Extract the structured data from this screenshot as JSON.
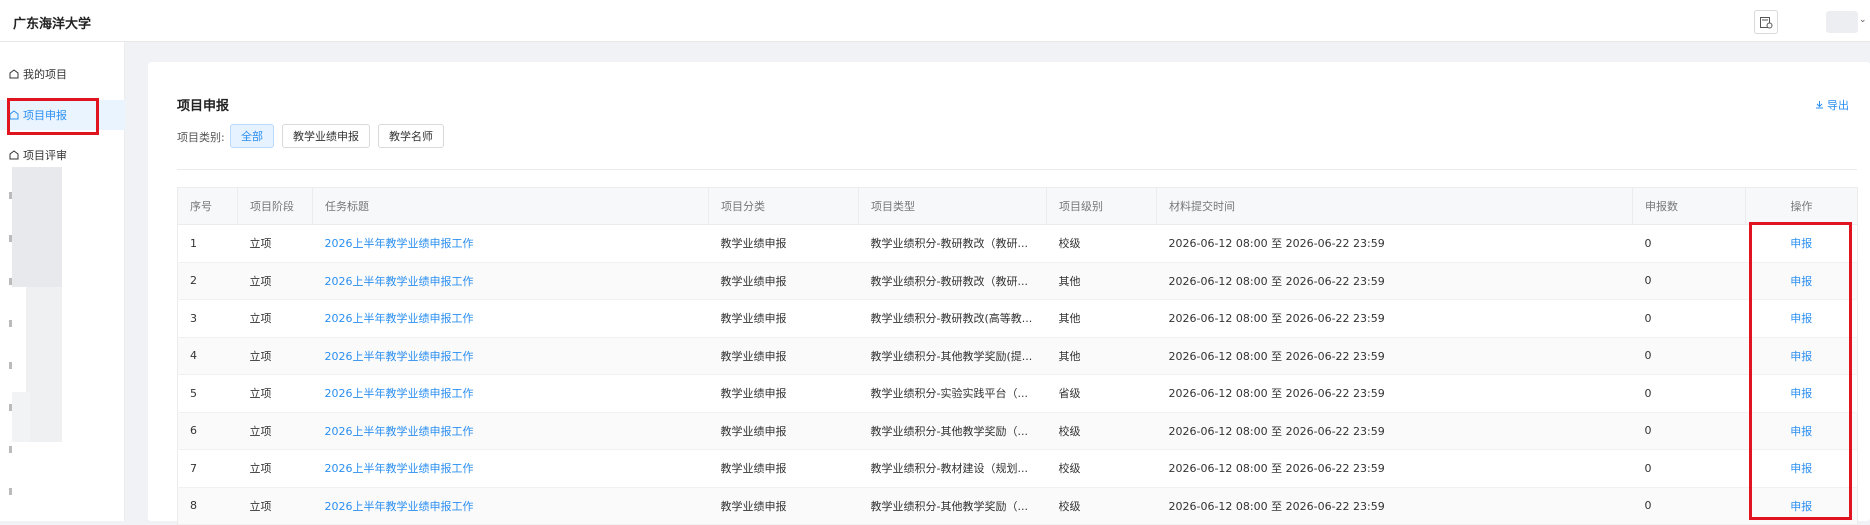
{
  "app": {
    "title": "广东海洋大学"
  },
  "sidebar": {
    "items": [
      {
        "label": "我的项目"
      },
      {
        "label": "项目申报"
      },
      {
        "label": "项目评审"
      }
    ]
  },
  "page": {
    "title": "项目申报",
    "export_label": "导出",
    "filter_label": "项目类别:",
    "filters": [
      "全部",
      "教学业绩申报",
      "教学名师"
    ]
  },
  "table": {
    "columns": [
      "序号",
      "项目阶段",
      "任务标题",
      "项目分类",
      "项目类型",
      "项目级别",
      "材料提交时间",
      "申报数",
      "操作"
    ],
    "rows": [
      [
        "1",
        "立项",
        "2026上半年教学业绩申报工作",
        "教学业绩申报",
        "教学业绩积分-教研教改（教研...",
        "校级",
        "2026-06-12 08:00 至 2026-06-22 23:59",
        "0",
        "申报"
      ],
      [
        "2",
        "立项",
        "2026上半年教学业绩申报工作",
        "教学业绩申报",
        "教学业绩积分-教研教改（教研...",
        "其他",
        "2026-06-12 08:00 至 2026-06-22 23:59",
        "0",
        "申报"
      ],
      [
        "3",
        "立项",
        "2026上半年教学业绩申报工作",
        "教学业绩申报",
        "教学业绩积分-教研教改(高等教...",
        "其他",
        "2026-06-12 08:00 至 2026-06-22 23:59",
        "0",
        "申报"
      ],
      [
        "4",
        "立项",
        "2026上半年教学业绩申报工作",
        "教学业绩申报",
        "教学业绩积分-其他教学奖励(提...",
        "其他",
        "2026-06-12 08:00 至 2026-06-22 23:59",
        "0",
        "申报"
      ],
      [
        "5",
        "立项",
        "2026上半年教学业绩申报工作",
        "教学业绩申报",
        "教学业绩积分-实验实践平台（...",
        "省级",
        "2026-06-12 08:00 至 2026-06-22 23:59",
        "0",
        "申报"
      ],
      [
        "6",
        "立项",
        "2026上半年教学业绩申报工作",
        "教学业绩申报",
        "教学业绩积分-其他教学奖励（...",
        "校级",
        "2026-06-12 08:00 至 2026-06-22 23:59",
        "0",
        "申报"
      ],
      [
        "7",
        "立项",
        "2026上半年教学业绩申报工作",
        "教学业绩申报",
        "教学业绩积分-教材建设（规划...",
        "校级",
        "2026-06-12 08:00 至 2026-06-22 23:59",
        "0",
        "申报"
      ],
      [
        "8",
        "立项",
        "2026上半年教学业绩申报工作",
        "教学业绩申报",
        "教学业绩积分-其他教学奖励（...",
        "校级",
        "2026-06-12 08:00 至 2026-06-22 23:59",
        "0",
        "申报"
      ]
    ]
  },
  "colors": {
    "accent": "#2b8ff0",
    "highlight": "#e0141e"
  },
  "icons": {
    "sidebar": "building-icon",
    "top": "calendar-icon",
    "export": "download-icon"
  }
}
